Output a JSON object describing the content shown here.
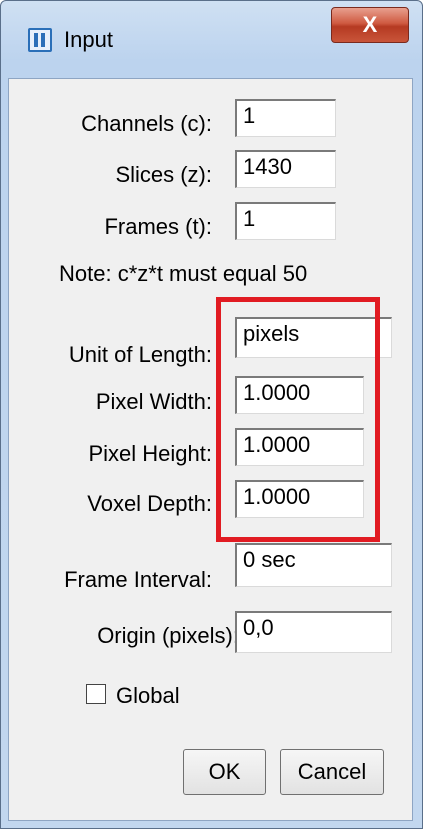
{
  "window": {
    "title": "Input",
    "close_glyph": "X"
  },
  "fields": {
    "channels": {
      "label": "Channels (c):",
      "value": "1"
    },
    "slices": {
      "label": "Slices (z):",
      "value": "1430"
    },
    "frames": {
      "label": "Frames (t):",
      "value": "1"
    },
    "unit": {
      "label": "Unit of Length:",
      "value": "pixels"
    },
    "pixel_width": {
      "label": "Pixel Width:",
      "value": "1.0000"
    },
    "pixel_height": {
      "label": "Pixel Height:",
      "value": "1.0000"
    },
    "voxel_depth": {
      "label": "Voxel Depth:",
      "value": "1.0000"
    },
    "frame_interval": {
      "label": "Frame Interval:",
      "value": "0 sec"
    },
    "origin": {
      "label": "Origin (pixels):",
      "value": "0,0"
    }
  },
  "note": "Note: c*z*t must equal 50",
  "global": {
    "label": "Global",
    "checked": false
  },
  "buttons": {
    "ok": "OK",
    "cancel": "Cancel"
  },
  "icons": {
    "app": "imagej-icon",
    "close": "close-icon"
  },
  "colors": {
    "highlight": "#e11b22"
  }
}
